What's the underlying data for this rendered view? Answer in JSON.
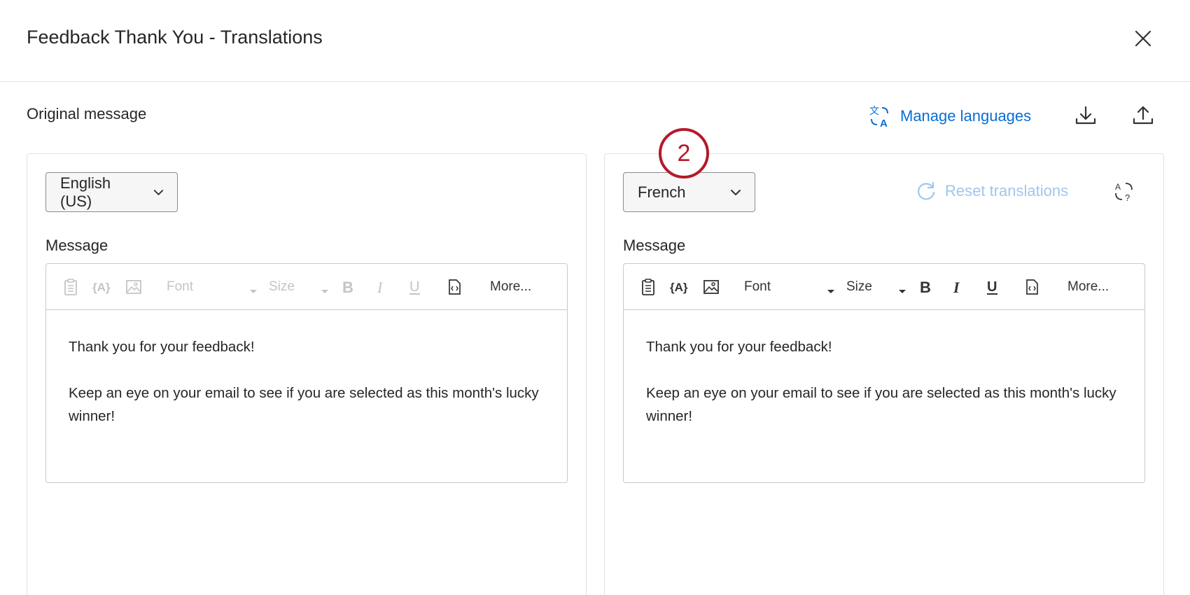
{
  "header": {
    "title": "Feedback Thank You - Translations"
  },
  "original_label": "Original message",
  "actions": {
    "manage_languages": "Manage languages"
  },
  "left_panel": {
    "language": "English (US)",
    "message_label": "Message",
    "toolbar": {
      "font": "Font",
      "size": "Size",
      "more": "More..."
    },
    "content": [
      "Thank you for your feedback!",
      "Keep an eye on your email to see if you are selected as this month's lucky winner!"
    ]
  },
  "right_panel": {
    "language": "French",
    "reset_label": "Reset translations",
    "message_label": "Message",
    "toolbar": {
      "font": "Font",
      "size": "Size",
      "more": "More..."
    },
    "content": [
      "Thank you for your feedback!",
      "Keep an eye on your email to see if you are selected as this month's lucky winner!"
    ]
  },
  "step_badge": "2",
  "colors": {
    "link_blue": "#0b6ed0",
    "disabled_blue": "#9fc6ee",
    "badge_red": "#b5192a",
    "border": "#c9c9c9"
  },
  "icons": [
    "close-icon",
    "translate-icon",
    "download-icon",
    "upload-icon",
    "chevron-down-icon",
    "refresh-icon",
    "auto-translate-icon",
    "clipboard-icon",
    "piped-text-icon",
    "image-icon",
    "bold-icon",
    "italic-icon",
    "underline-icon",
    "source-code-icon"
  ]
}
